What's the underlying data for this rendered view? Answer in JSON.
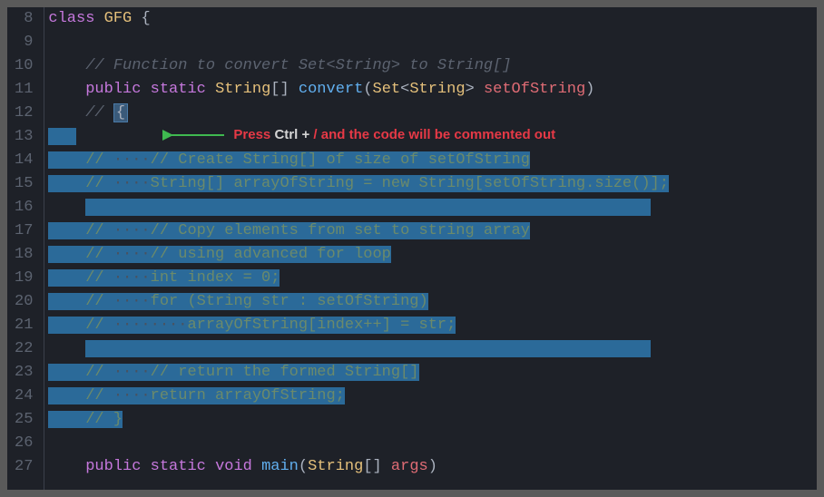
{
  "lineNumbers": [
    "8",
    "9",
    "10",
    "11",
    "12",
    "13",
    "14",
    "15",
    "16",
    "17",
    "18",
    "19",
    "20",
    "21",
    "22",
    "23",
    "24",
    "25",
    "26",
    "27"
  ],
  "code": {
    "l8": {
      "kw1": "class",
      "cls": "GFG",
      "brace": "{"
    },
    "l10": {
      "comment": "// Function to convert Set<String> to String[]"
    },
    "l11": {
      "kw1": "public",
      "kw2": "static",
      "type1": "String",
      "fn": "convert",
      "type2": "Set",
      "type3": "String",
      "param": "setOfString"
    },
    "l12": {
      "comment": "// ",
      "brace": "{"
    },
    "l14": {
      "p1": "// ",
      "ws": "····",
      "p2": "// Create String[] of size of setOfString"
    },
    "l15": {
      "p1": "// ",
      "ws": "····",
      "p2": "String[] arrayOfString = new String[setOfString.size()];"
    },
    "l17": {
      "p1": "// ",
      "ws": "····",
      "p2": "// Copy elements from set to string array"
    },
    "l18": {
      "p1": "// ",
      "ws": "····",
      "p2": "// using advanced for loop"
    },
    "l19": {
      "p1": "// ",
      "ws": "····",
      "p2": "int index = 0;"
    },
    "l20": {
      "p1": "// ",
      "ws": "····",
      "p2": "for (String str : setOfString)"
    },
    "l21": {
      "p1": "// ",
      "ws": "········",
      "p2": "arrayOfString[index++] = str;"
    },
    "l23": {
      "p1": "// ",
      "ws": "····",
      "p2": "// return the formed String[]"
    },
    "l24": {
      "p1": "// ",
      "ws": "····",
      "p2": "return arrayOfString;"
    },
    "l25": {
      "p1": "// ",
      "p2": "}"
    },
    "l27": {
      "kw1": "public",
      "kw2": "static",
      "kw3": "void",
      "fn": "main",
      "type": "String",
      "param": "args"
    }
  },
  "annotation": {
    "press": "Press ",
    "ctrl": "Ctrl + ",
    "slash": "/ ",
    "rest": "and the code will be commented out"
  },
  "wsChar": "·",
  "indent4": "    ",
  "indent8": "        "
}
